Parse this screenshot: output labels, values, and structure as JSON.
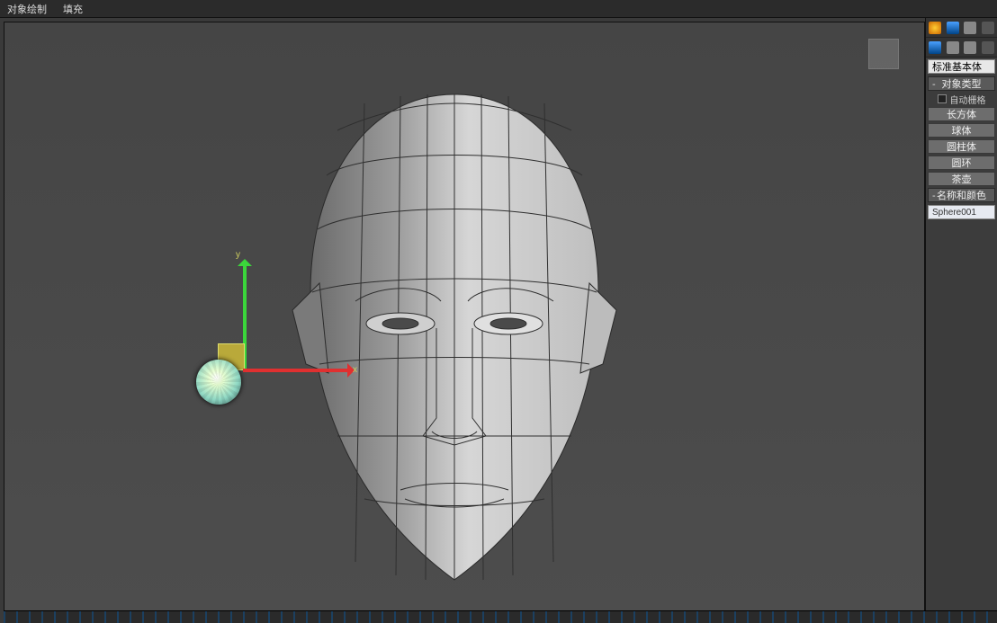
{
  "topbar": {
    "item1": "对象绘制",
    "item2": "填充"
  },
  "gizmo": {
    "x_label": "x",
    "y_label": "y"
  },
  "side": {
    "dropdown": "标准基本体",
    "section_object_type": "对象类型",
    "auto_grid": "自动栅格",
    "primitives": [
      "长方体",
      "球体",
      "圆柱体",
      "圆环",
      "茶壶"
    ],
    "section_name_color": "名称和颜色",
    "object_name": "Sphere001"
  }
}
